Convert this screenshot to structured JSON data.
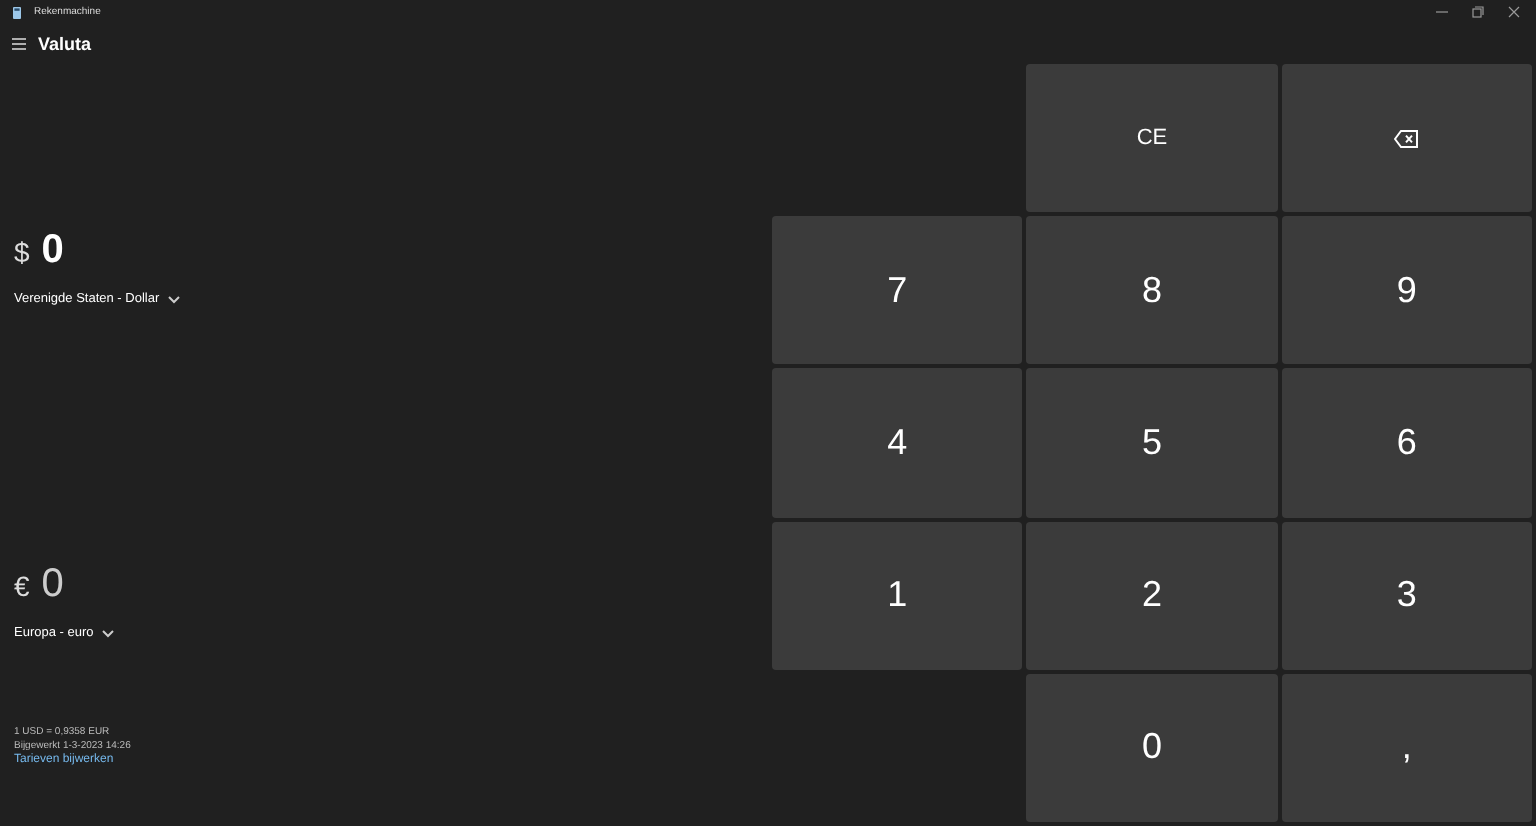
{
  "window": {
    "title": "Rekenmachine"
  },
  "header": {
    "title": "Valuta"
  },
  "from": {
    "symbol": "$",
    "value": "0",
    "currency": "Verenigde Staten - Dollar",
    "active": true
  },
  "to": {
    "symbol": "€",
    "value": "0",
    "currency": "Europa - euro",
    "active": false
  },
  "rate": {
    "line": "1 USD = 0,9358 EUR",
    "updated": "Bijgewerkt 1-3-2023 14:26",
    "link": "Tarieven bijwerken"
  },
  "keys": [
    {
      "kind": "blank"
    },
    {
      "kind": "text",
      "label": "CE"
    },
    {
      "kind": "backspace"
    },
    {
      "kind": "text",
      "label": "7"
    },
    {
      "kind": "text",
      "label": "8"
    },
    {
      "kind": "text",
      "label": "9"
    },
    {
      "kind": "text",
      "label": "4"
    },
    {
      "kind": "text",
      "label": "5"
    },
    {
      "kind": "text",
      "label": "6"
    },
    {
      "kind": "text",
      "label": "1"
    },
    {
      "kind": "text",
      "label": "2"
    },
    {
      "kind": "text",
      "label": "3"
    },
    {
      "kind": "blank"
    },
    {
      "kind": "text",
      "label": "0"
    },
    {
      "kind": "text",
      "label": ","
    }
  ]
}
